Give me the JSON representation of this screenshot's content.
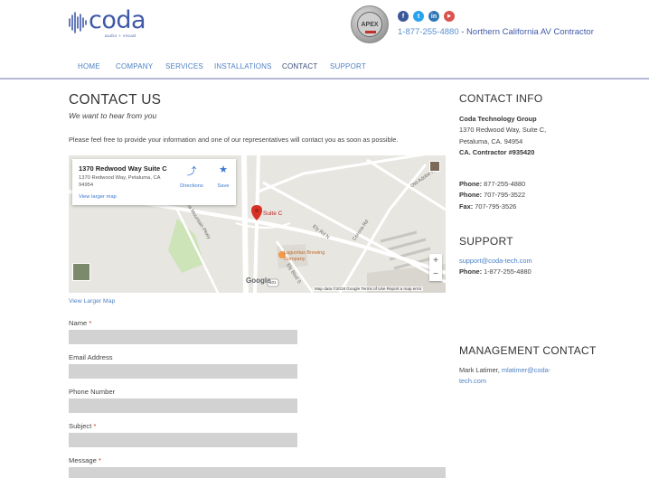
{
  "header": {
    "logo_text": "coda",
    "logo_tagline": "audio + visual",
    "badge_text": "APEX",
    "social": [
      {
        "icon": "facebook-icon",
        "glyph": "f",
        "color": "#3b5998"
      },
      {
        "icon": "twitter-icon",
        "glyph": "t",
        "color": "#2aa3ef"
      },
      {
        "icon": "linkedin-icon",
        "glyph": "in",
        "color": "#3276b5"
      },
      {
        "icon": "youtube-icon",
        "glyph": "▶",
        "color": "#d9534f"
      }
    ],
    "phone": "1-877-255-4880",
    "phone_suffix": " - Northern California AV Contractor"
  },
  "nav": {
    "items": [
      {
        "label": "HOME"
      },
      {
        "label": "COMPANY"
      },
      {
        "label": "SERVICES"
      },
      {
        "label": "INSTALLATIONS"
      },
      {
        "label": "CONTACT"
      },
      {
        "label": "SUPPORT"
      }
    ],
    "active": "CONTACT"
  },
  "main": {
    "title": "CONTACT US",
    "subtitle": "We want to hear from you",
    "intro": "Please feel free to provide your information and one of our representatives will contact you as soon as possible.",
    "map": {
      "card_title": "1370 Redwood Way Suite C",
      "card_address": "1370 Redwood Way, Petaluma, CA 94954",
      "card_link": "View larger map",
      "directions_label": "Directions",
      "save_label": "Save",
      "pin_label": "Suite C",
      "place_label": "Lagunitas Brewing Company",
      "road_labels": [
        "Old Adobe Rd",
        "Ely Rd N",
        "Corona Rd",
        "Ely Blvd S",
        "Sonoma Mountain Pkwy"
      ],
      "route_badge": "101",
      "google": "Google",
      "footer": "Map data ©2018 Google   Terms of Use   Report a map error",
      "zoom_in": "+",
      "zoom_out": "−"
    },
    "view_larger_map": "View Larger Map",
    "form": {
      "fields": [
        {
          "label": "Name",
          "required": "*"
        },
        {
          "label": "Email Address",
          "required": ""
        },
        {
          "label": "Phone Number",
          "required": ""
        },
        {
          "label": "Subject",
          "required": "*"
        },
        {
          "label": "Message",
          "required": "*"
        }
      ]
    }
  },
  "sidebar": {
    "contact_heading": "CONTACT INFO",
    "company": "Coda Technology Group",
    "address1": "1370 Redwood Way, Suite C,",
    "address2": "Petaluma, CA. 94954",
    "contractor": "CA. Contractor #935420",
    "phone_label": "Phone:",
    "phone1": "877-255-4880",
    "phone2": "707-795-3522",
    "fax_label": "Fax:",
    "fax": "707-795-3526",
    "support_heading": "SUPPORT",
    "support_email": "support@coda-tech.com",
    "support_phone": "1-877-255-4880",
    "management_heading": "MANAGEMENT CONTACT",
    "manager_name": "Mark Latimer,",
    "manager_email_line1": "mlatimer@coda-",
    "manager_email_line2": "tech.com"
  }
}
